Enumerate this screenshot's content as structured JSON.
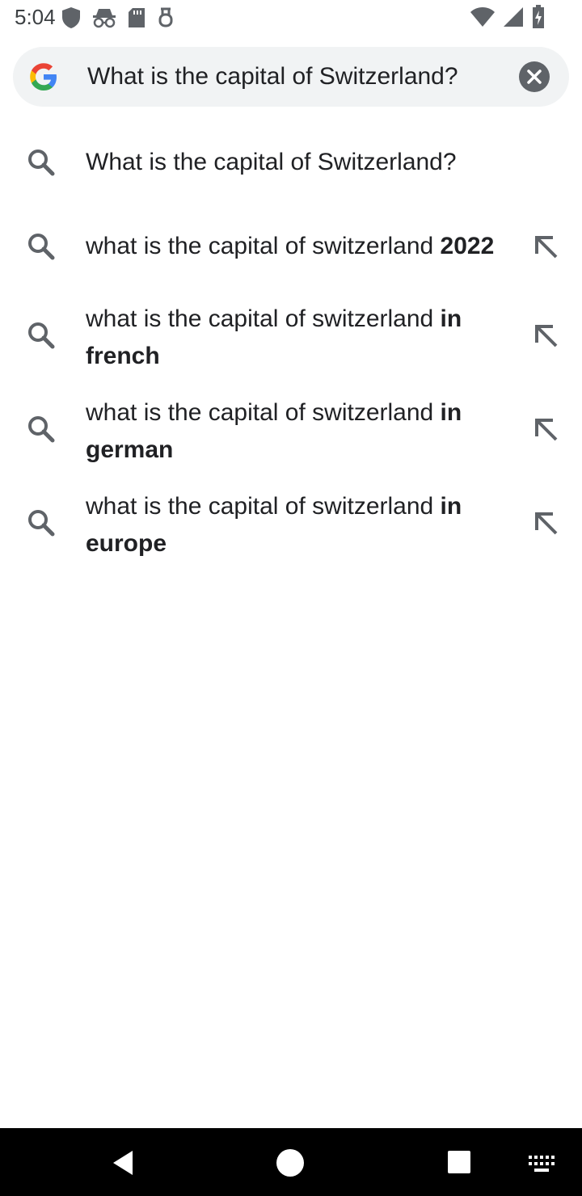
{
  "status_bar": {
    "time": "5:04",
    "left_icons": [
      "shield-icon",
      "incognito-icon",
      "sd-card-icon",
      "usb-icon"
    ],
    "right_icons": [
      "wifi-icon",
      "cell-signal-icon",
      "battery-icon"
    ]
  },
  "search": {
    "query": "What is the capital of Switzerland?",
    "logo": "google-g-logo",
    "clear_icon": "close-icon"
  },
  "suggestions": [
    {
      "prefix": "What is the capital of Switzerland?",
      "bold": "",
      "type": "search",
      "has_arrow": false
    },
    {
      "prefix": "what is the capital of switzerland ",
      "bold": "2022",
      "type": "search",
      "has_arrow": true
    },
    {
      "prefix": "what is the capital of switzerland ",
      "bold": "in french",
      "type": "search",
      "has_arrow": true
    },
    {
      "prefix": "what is the capital of switzerland ",
      "bold": "in german",
      "type": "search",
      "has_arrow": true
    },
    {
      "prefix": "what is the capital of switzerland ",
      "bold": "in europe",
      "type": "search",
      "has_arrow": true
    }
  ],
  "nav_bar": {
    "buttons": [
      "back-icon",
      "home-icon",
      "recents-icon",
      "keyboard-icon"
    ]
  },
  "colors": {
    "search_bg": "#f1f3f4",
    "text": "#202124",
    "icon_gray": "#5f6368",
    "nav_bg": "#000000"
  }
}
